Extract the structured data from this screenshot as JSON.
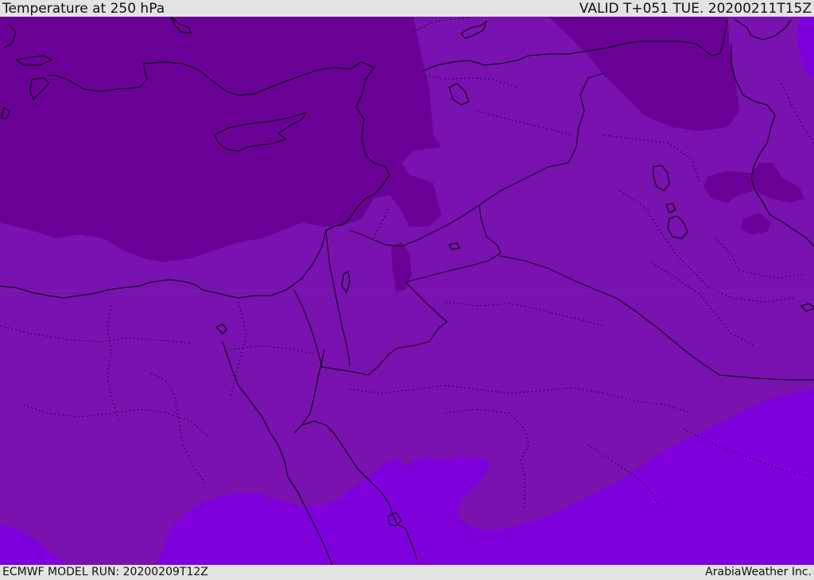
{
  "header": {
    "title": "Temperature at 250 hPa",
    "valid": "VALID T+051 TUE. 20200211T15Z"
  },
  "footer": {
    "model_run": "ECMWF MODEL RUN: 20200209T12Z",
    "credit": "ArabiaWeather Inc."
  },
  "map": {
    "colors": {
      "coldest": "#6a0096",
      "mid": "#7a12b0",
      "warmest": "#7f00dc",
      "border": "#000000"
    }
  }
}
